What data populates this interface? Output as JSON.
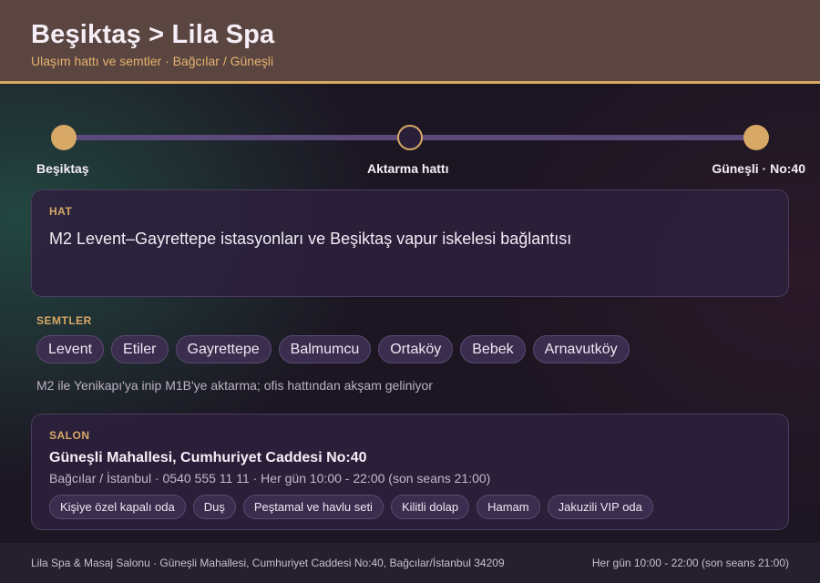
{
  "header": {
    "title": "Beşiktaş > Lila Spa",
    "subtitle": "Ulaşım hattı ve semtler · Bağcılar / Güneşli"
  },
  "timeline": {
    "stops": [
      {
        "label": "Beşiktaş",
        "state": "filled"
      },
      {
        "label": "Aktarma hattı",
        "state": "hollow"
      },
      {
        "label": "Güneşli · No:40",
        "state": "filled"
      }
    ]
  },
  "hat": {
    "eyebrow": "HAT",
    "text": "M2 Levent–Gayrettepe istasyonları ve Beşiktaş vapur iskelesi bağlantısı"
  },
  "semtler": {
    "label": "SEMTLER",
    "items": [
      "Levent",
      "Etiler",
      "Gayrettepe",
      "Balmumcu",
      "Ortaköy",
      "Bebek",
      "Arnavutköy"
    ],
    "note": "M2 ile Yenikapı'ya inip M1B'ye aktarma; ofis hattından akşam geliniyor"
  },
  "salon": {
    "eyebrow": "SALON",
    "title": "Güneşli Mahallesi, Cumhuriyet Caddesi No:40",
    "meta": "Bağcılar / İstanbul · 0540 555 11 11 · Her gün 10:00 - 22:00 (son seans 21:00)",
    "amenities": [
      "Kişiye özel kapalı oda",
      "Duş",
      "Peştamal ve havlu seti",
      "Kilitli dolap",
      "Hamam",
      "Jakuzili VIP oda"
    ]
  },
  "footer": {
    "left": "Lila Spa & Masaj Salonu · Güneşli Mahallesi, Cumhuriyet Caddesi No:40, Bağcılar/İstanbul 34209",
    "right": "Her gün 10:00 - 22:00 (son seans 21:00)"
  },
  "colors": {
    "accent": "#d8a866",
    "header_bg": "#5a4540",
    "line": "#5b4a7a"
  }
}
